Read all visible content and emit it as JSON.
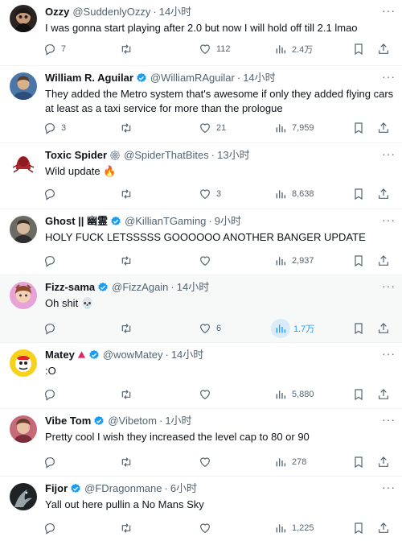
{
  "colors": {
    "verified": "#1d9bf0",
    "muted": "#536471",
    "text": "#0f1419",
    "hover_bg": "#f7f9f9"
  },
  "icons": {
    "verified": "verified-badge-icon",
    "reply": "reply-icon",
    "retweet": "retweet-icon",
    "like": "heart-icon",
    "views": "views-icon",
    "bookmark": "bookmark-icon",
    "share": "share-icon",
    "more": "more-icon"
  },
  "tweets": [
    {
      "name": "Ozzy",
      "verified": false,
      "extra": "",
      "handle": "@SuddenlyOzzy",
      "time": "14小时",
      "text": "I was gonna start playing after 2.0 but now I will hold off till 2.1 lmao",
      "replies": "7",
      "retweets": "",
      "likes": "112",
      "views": "2.4万"
    },
    {
      "name": "William R. Aguilar",
      "verified": true,
      "extra": "",
      "handle": "@WilliamRAguilar",
      "time": "14小时",
      "text": "They added the Metro system that's awesome if only they added flying cars at least as a taxi service for more than the prologue",
      "replies": "3",
      "retweets": "",
      "likes": "21",
      "views": "7,959"
    },
    {
      "name": "Toxic Spider",
      "verified": false,
      "extra": "web-icon",
      "handle": "@SpiderThatBites",
      "time": "13小时",
      "text": "Wild update 🔥",
      "replies": "",
      "retweets": "",
      "likes": "3",
      "views": "8,638"
    },
    {
      "name": "Ghost || 幽霊",
      "verified": true,
      "extra": "",
      "handle": "@KillianTGaming",
      "time": "9小时",
      "text": "HOLY FUCK LETSSSSS GOOOOOO ANOTHER BANGER UPDATE",
      "replies": "",
      "retweets": "",
      "likes": "",
      "views": "2,937"
    },
    {
      "name": "Fizz-sama",
      "verified": true,
      "extra": "",
      "handle": "@FizzAgain",
      "time": "14小时",
      "text": "Oh shit 💀",
      "replies": "",
      "retweets": "",
      "likes": "6",
      "views": "1.7万"
    },
    {
      "name": "Matey",
      "verified": true,
      "extra": "triangle-icon",
      "handle": "@wowMatey",
      "time": "14小时",
      "text": ":O",
      "replies": "",
      "retweets": "",
      "likes": "",
      "views": "5,880"
    },
    {
      "name": "Vibe Tom",
      "verified": true,
      "extra": "",
      "handle": "@Vibetom",
      "time": "1小时",
      "text": "Pretty cool I wish they increased the level cap to 80 or 90",
      "replies": "",
      "retweets": "",
      "likes": "",
      "views": "278"
    },
    {
      "name": "Fijor",
      "verified": true,
      "extra": "",
      "handle": "@FDragonmane",
      "time": "6小时",
      "text": "Yall out here pullin a No Mans Sky",
      "replies": "",
      "retweets": "",
      "likes": "",
      "views": "1,225"
    }
  ]
}
